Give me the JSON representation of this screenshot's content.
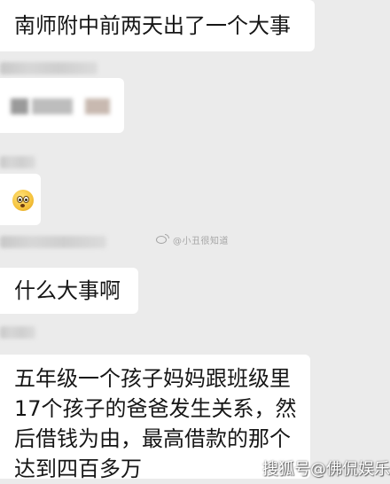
{
  "messages": {
    "m1": "南师附中前两天出了一个大事",
    "m4": "什么大事啊",
    "m5_lines": [
      "五年级一个孩子妈妈跟班级里",
      "17个孩子的爸爸发生关系，然",
      "后借钱为由，最高借款的那个",
      "达到四百多万"
    ]
  },
  "watermarks": {
    "center": "@小丑很知道",
    "corner": "搜狐号@佛侃娱乐"
  },
  "colors": {
    "background": "#ebebeb",
    "bubble": "#ffffff",
    "text": "#161616"
  },
  "icons": {
    "emoji": "face-with-open-mouth-emoji",
    "watermark": "weibo-logo"
  }
}
